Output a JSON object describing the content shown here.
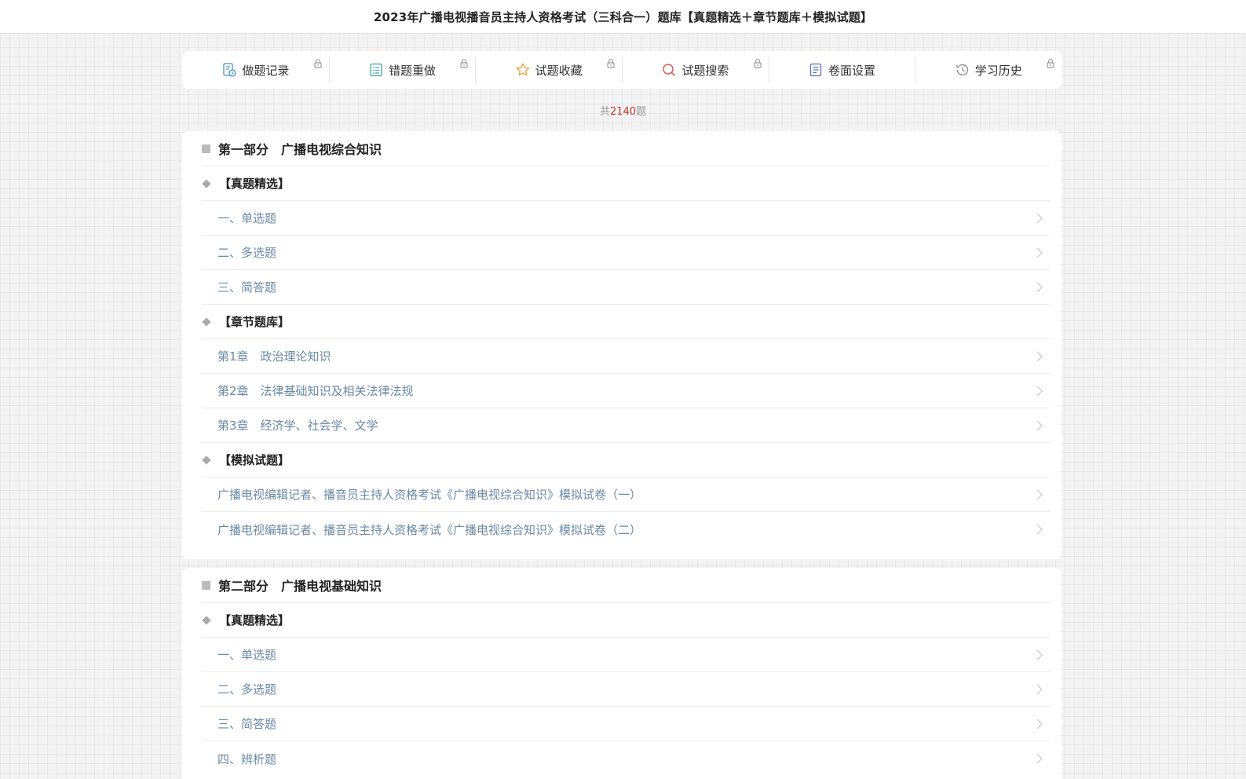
{
  "header": {
    "title": "2023年广播电视播音员主持人资格考试（三科合一）题库【真题精选＋章节题库＋模拟试题】"
  },
  "toolbar": {
    "items": [
      {
        "label": "做题记录",
        "icon": "record-icon",
        "locked": true
      },
      {
        "label": "错题重做",
        "icon": "redo-icon",
        "locked": true
      },
      {
        "label": "试题收藏",
        "icon": "star-icon",
        "locked": true
      },
      {
        "label": "试题搜索",
        "icon": "search-icon",
        "locked": true
      },
      {
        "label": "卷面设置",
        "icon": "settings-doc-icon",
        "locked": false
      },
      {
        "label": "学习历史",
        "icon": "history-icon",
        "locked": true
      }
    ]
  },
  "count": {
    "prefix": "共",
    "number": "2140",
    "suffix": "题"
  },
  "parts": [
    {
      "title": "第一部分　广播电视综合知识",
      "categories": [
        {
          "title": "【真题精选】",
          "items": [
            "一、单选题",
            "二、多选题",
            "三、简答题"
          ]
        },
        {
          "title": "【章节题库】",
          "items": [
            "第1章　政治理论知识",
            "第2章　法律基础知识及相关法律法规",
            "第3章　经济学、社会学、文学"
          ]
        },
        {
          "title": "【模拟试题】",
          "items": [
            "广播电视编辑记者、播音员主持人资格考试《广播电视综合知识》模拟试卷（一）",
            "广播电视编辑记者、播音员主持人资格考试《广播电视综合知识》模拟试卷（二）"
          ]
        }
      ]
    },
    {
      "title": "第二部分　广播电视基础知识",
      "categories": [
        {
          "title": "【真题精选】",
          "items": [
            "一、单选题",
            "二、多选题",
            "三、简答题",
            "四、辨析题"
          ]
        }
      ]
    }
  ],
  "colors": {
    "item_text": "#6a8aa5",
    "count_number": "#c0392b",
    "icon_blue": "#4a90c2",
    "icon_teal": "#3aa8a0",
    "icon_orange": "#e8a13a",
    "icon_red": "#d9534f",
    "icon_purple": "#5a6fb8"
  }
}
